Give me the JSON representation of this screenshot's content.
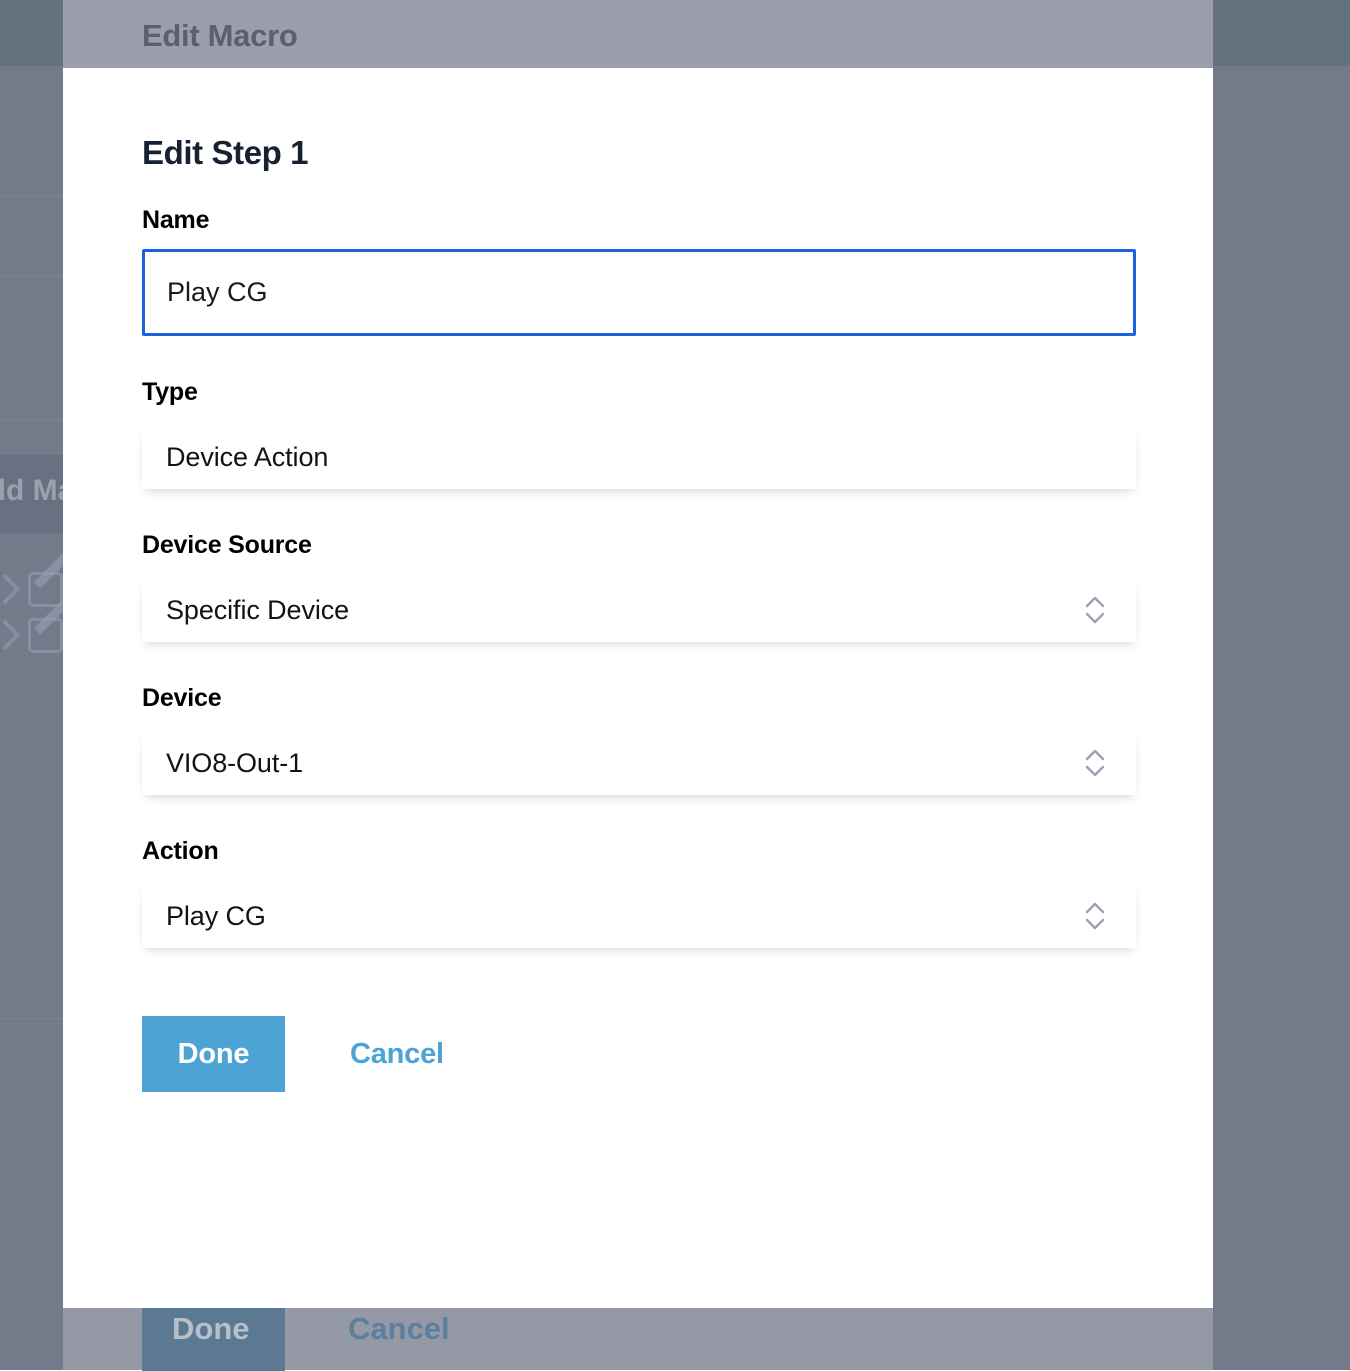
{
  "background_app": {
    "modal_title": "Edit Macro",
    "add_macro_button_label": "Add Macro",
    "done_label": "Done",
    "cancel_label": "Cancel",
    "overlay_color": "#737a89"
  },
  "dialog": {
    "title": "Edit Step 1",
    "fields": {
      "name": {
        "label": "Name",
        "value": "Play CG",
        "placeholder": "",
        "focused": true,
        "focus_color": "#1b62e0"
      },
      "type": {
        "label": "Type",
        "value": "Device Action",
        "has_chevrons": false
      },
      "device_source": {
        "label": "Device Source",
        "value": "Specific Device",
        "has_chevrons": true
      },
      "device": {
        "label": "Device",
        "value": "VIO8-Out-1",
        "has_chevrons": true
      },
      "action": {
        "label": "Action",
        "value": "Play CG",
        "has_chevrons": true
      }
    },
    "footer": {
      "done_label": "Done",
      "cancel_label": "Cancel",
      "done_color": "#4da3d4",
      "cancel_color": "#4da3d4"
    }
  }
}
